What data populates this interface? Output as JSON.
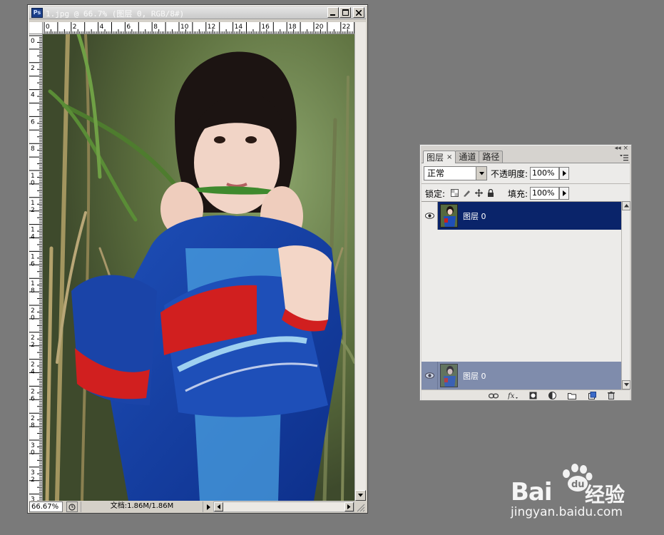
{
  "document": {
    "title": "1.jpg @ 66.7% (图层 0, RGB/8#)",
    "app_icon": "Ps",
    "zoom": "66.67%",
    "doc_info": "文档:1.86M/1.86M",
    "ruler_top_labels": [
      "0",
      "2",
      "4",
      "6",
      "8",
      "10",
      "12",
      "14",
      "16",
      "18",
      "20",
      "22"
    ],
    "ruler_left_labels": [
      "0",
      "2",
      "4",
      "6",
      "8",
      "10",
      "12",
      "14",
      "16",
      "18",
      "20",
      "22",
      "24",
      "26",
      "28",
      "30",
      "32",
      "3"
    ]
  },
  "layers_panel": {
    "tabs": [
      {
        "label": "图层",
        "active": true
      },
      {
        "label": "通道",
        "active": false
      },
      {
        "label": "路径",
        "active": false
      }
    ],
    "tab_close": "×",
    "window_controls": "◂◂ ×",
    "blend_mode": "正常",
    "opacity_label": "不透明度:",
    "opacity_value": "100%",
    "lock_label": "锁定:",
    "fill_label": "填充:",
    "fill_value": "100%",
    "layers": [
      {
        "name": "图层 0",
        "visible": true,
        "selected": true
      }
    ],
    "drag_preview_name": "图层 0"
  },
  "watermark": {
    "logo_text": "Bai",
    "paw_text": "du",
    "suffix": "经验",
    "url": "jingyan.baidu.com"
  },
  "icons": {
    "ps": "photoshop-app-icon",
    "eye": "eye-icon",
    "link": "link-icon",
    "fx": "fx-icon",
    "mask": "mask-icon",
    "adjust": "adjustment-icon",
    "group": "folder-icon",
    "new": "new-layer-icon",
    "trash": "trash-icon"
  }
}
